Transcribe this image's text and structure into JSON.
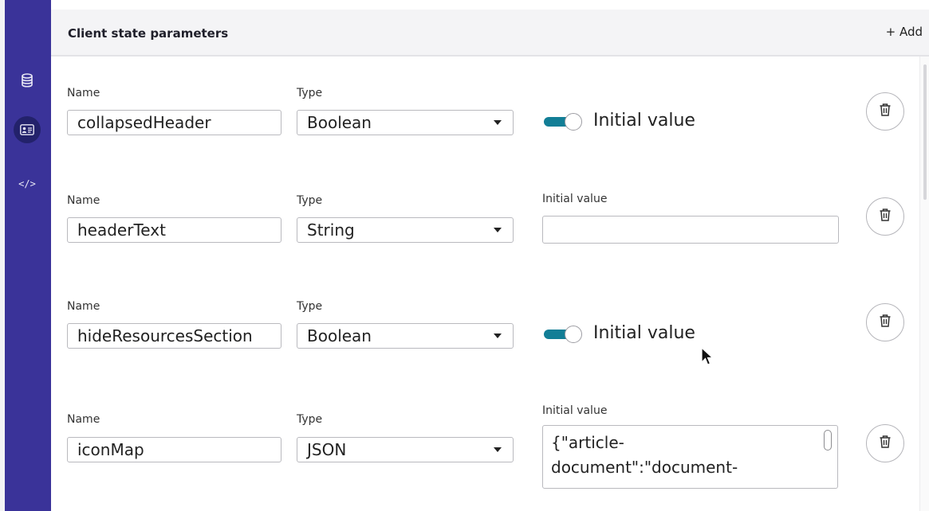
{
  "header": {
    "title": "Client state parameters",
    "add_label": "+ Add"
  },
  "sidebar": {
    "icons": [
      "database-icon",
      "variables-icon",
      "code-icon"
    ],
    "code_glyph": "</>"
  },
  "rows": [
    {
      "name_label": "Name",
      "name": "collapsedHeader",
      "type_label": "Type",
      "type": "Boolean",
      "value_label": "Initial value",
      "toggle_on": true
    },
    {
      "name_label": "Name",
      "name": "headerText",
      "type_label": "Type",
      "type": "String",
      "value_label": "Initial value",
      "value": ""
    },
    {
      "name_label": "Name",
      "name": "hideResourcesSection",
      "type_label": "Type",
      "type": "Boolean",
      "value_label": "Initial value",
      "toggle_on": true
    },
    {
      "name_label": "Name",
      "name": "iconMap",
      "type_label": "Type",
      "type": "JSON",
      "value_label": "Initial value",
      "value_line1": "{\"article-",
      "value_line2": "document\":\"document-"
    }
  ],
  "colors": {
    "sidebar": "#3a3399",
    "sidebar_active": "#23226b",
    "toggle": "#127e96"
  }
}
